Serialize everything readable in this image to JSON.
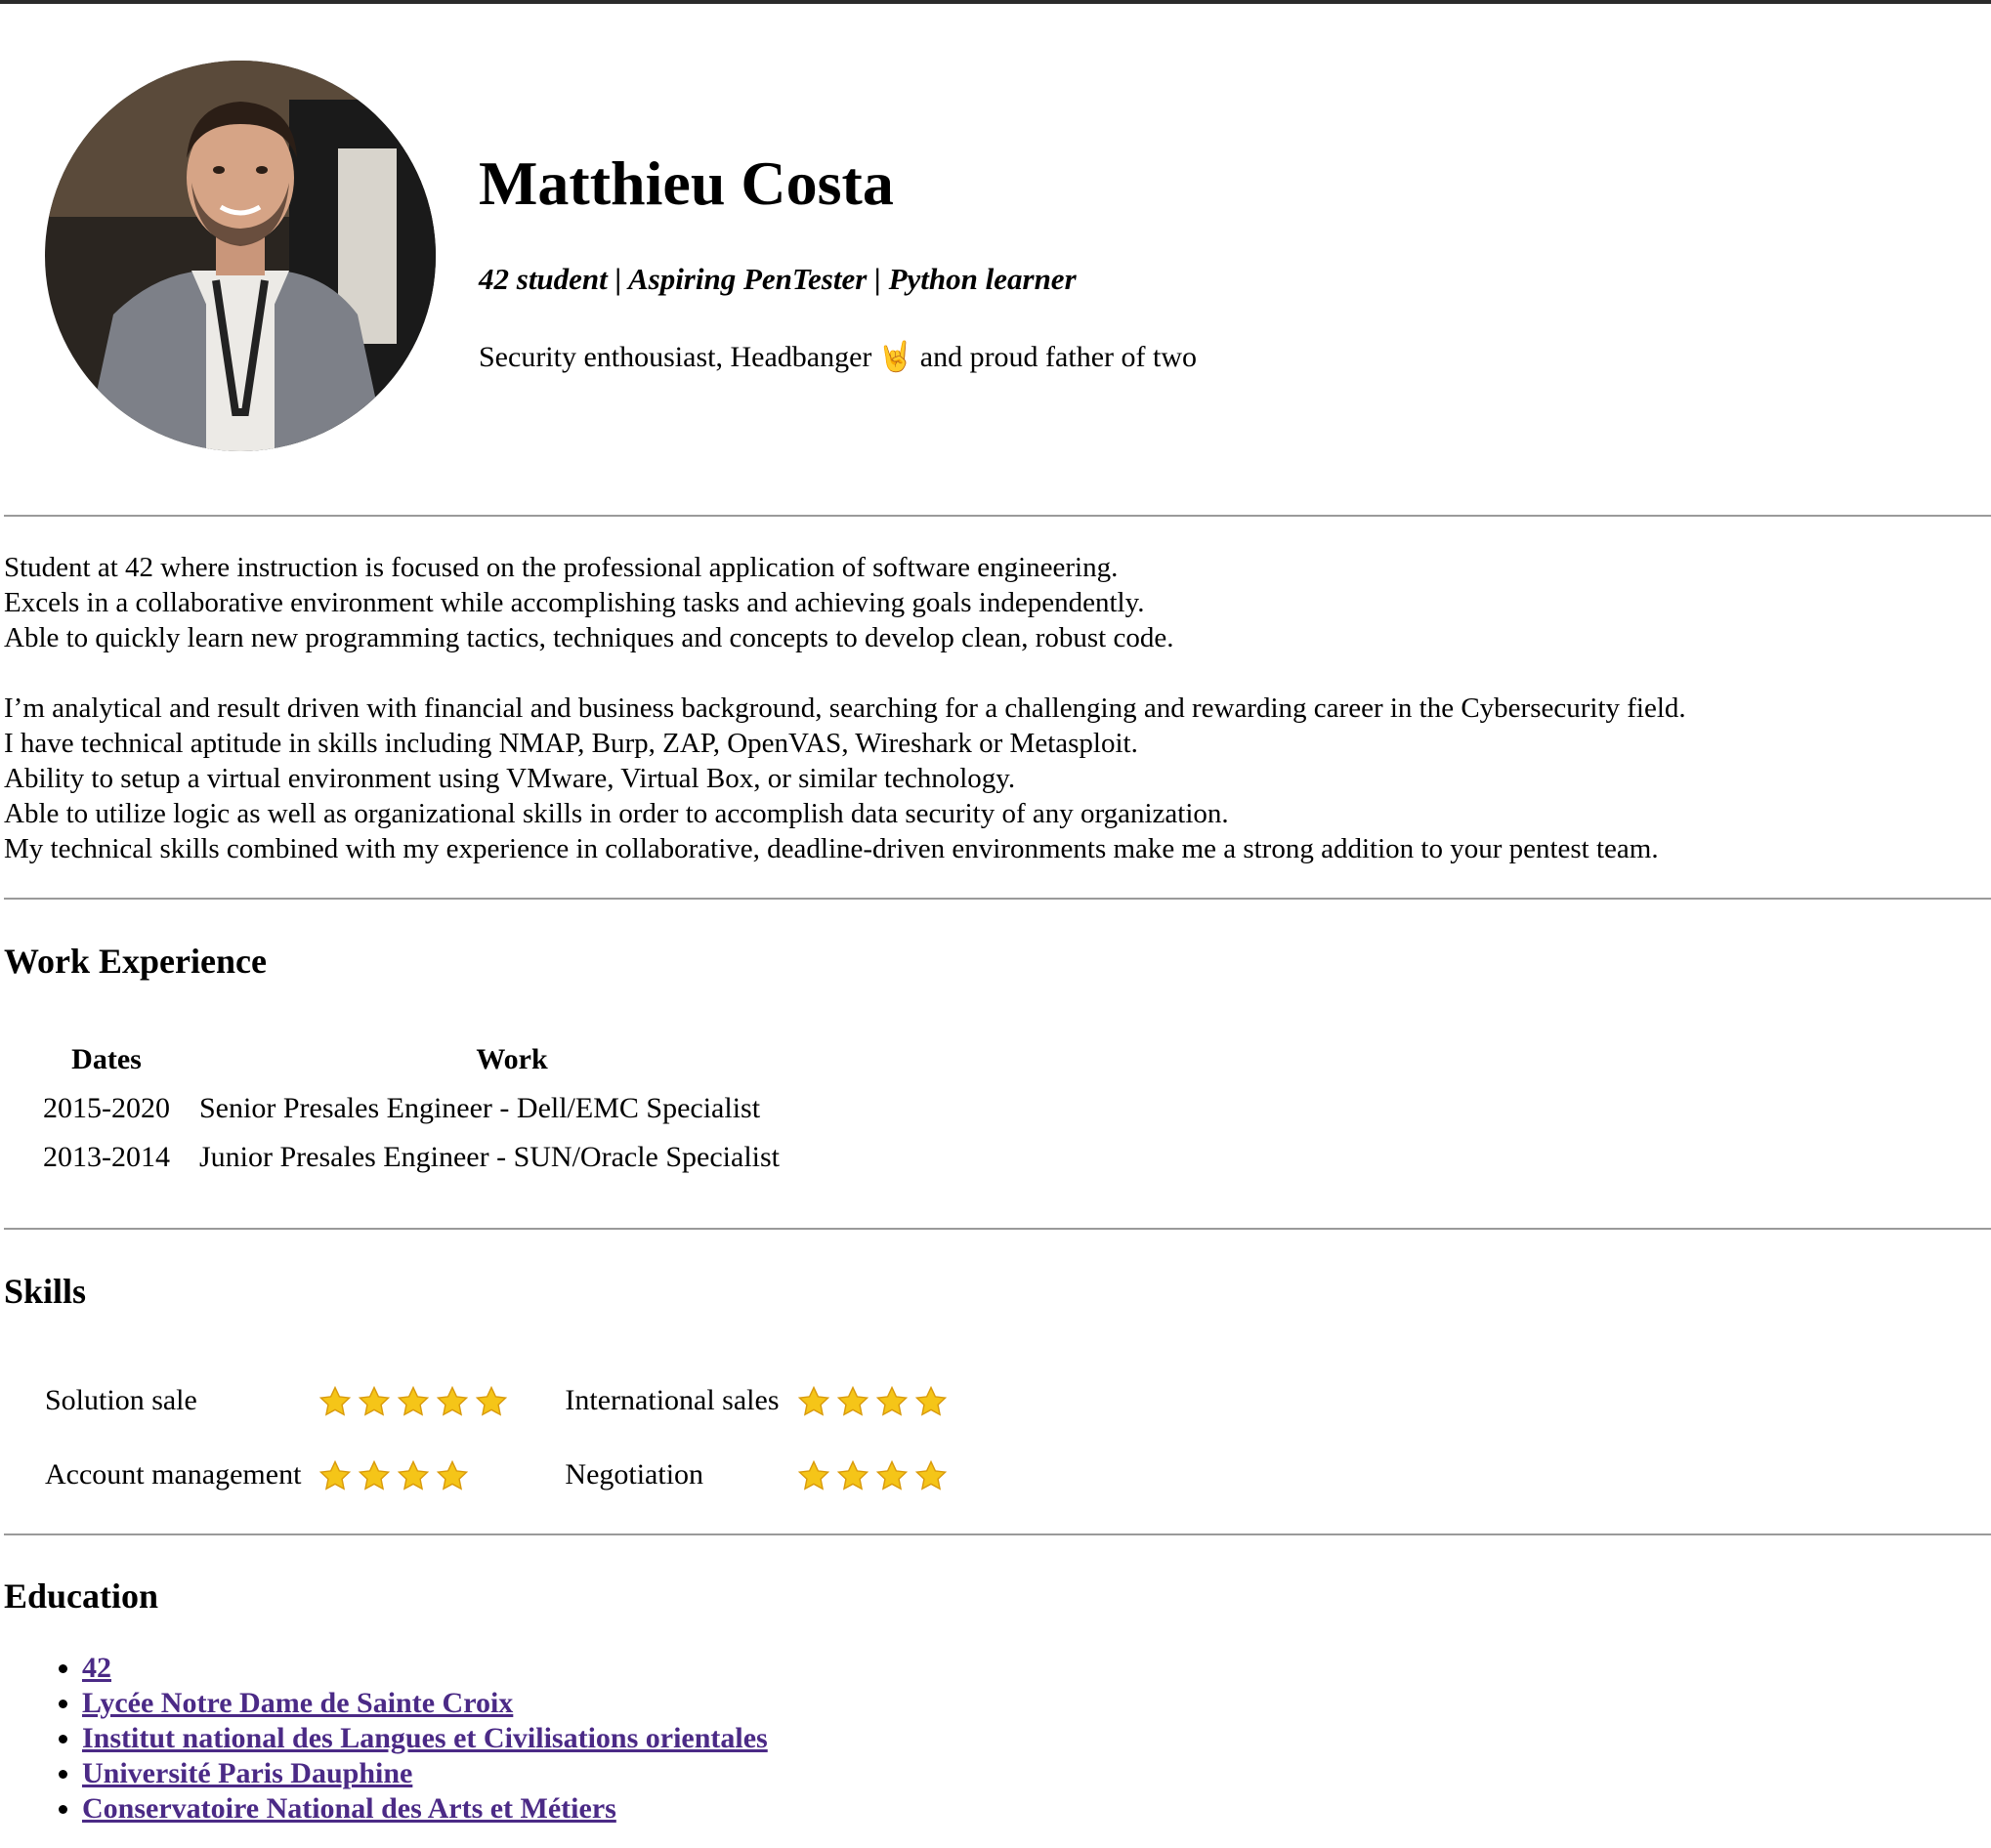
{
  "profile": {
    "name": "Matthieu Costa",
    "tagline": "42 student | Aspiring PenTester | Python learner",
    "motto_before": "Security enthousiast, Headbanger",
    "motto_emoji": "🤘",
    "motto_after": "and proud father of two"
  },
  "summary": {
    "paragraph1": [
      "Student at 42 where instruction is focused on the professional application of software engineering.",
      "Excels in a collaborative environment while accomplishing tasks and achieving goals independently.",
      "Able to quickly learn new programming tactics, techniques and concepts to develop clean, robust code."
    ],
    "paragraph2": [
      "I’m analytical and result driven with financial and business background, searching for a challenging and rewarding career in the Cybersecurity field.",
      "I have technical aptitude in skills including NMAP, Burp, ZAP, OpenVAS, Wireshark or Metasploit.",
      "Ability to setup a virtual environment using VMware, Virtual Box, or similar technology.",
      "Able to utilize logic as well as organizational skills in order to accomplish data security of any organization.",
      "My technical skills combined with my experience in collaborative, deadline-driven environments make me a strong addition to your pentest team."
    ]
  },
  "work": {
    "title": "Work Experience",
    "headers": [
      "Dates",
      "Work"
    ],
    "rows": [
      {
        "dates": "2015-2020",
        "work": "Senior Presales Engineer - Dell/EMC Specialist"
      },
      {
        "dates": "2013-2014",
        "work": "Junior Presales Engineer - SUN/Oracle Specialist"
      }
    ]
  },
  "skills": {
    "title": "Skills",
    "items": [
      {
        "name": "Solution sale",
        "stars": 5
      },
      {
        "name": "International sales",
        "stars": 4
      },
      {
        "name": "Account management",
        "stars": 4
      },
      {
        "name": "Negotiation",
        "stars": 4
      }
    ]
  },
  "education": {
    "title": "Education",
    "items": [
      "42",
      "Lycée Notre Dame de Sainte Croix",
      "Institut national des Langues et Civilisations orientales",
      "Université Paris Dauphine",
      "Conservatoire National des Arts et Métiers"
    ]
  },
  "colors": {
    "link": "#4b2a86",
    "divider": "#9a9a9a",
    "star": "#f5c518"
  }
}
